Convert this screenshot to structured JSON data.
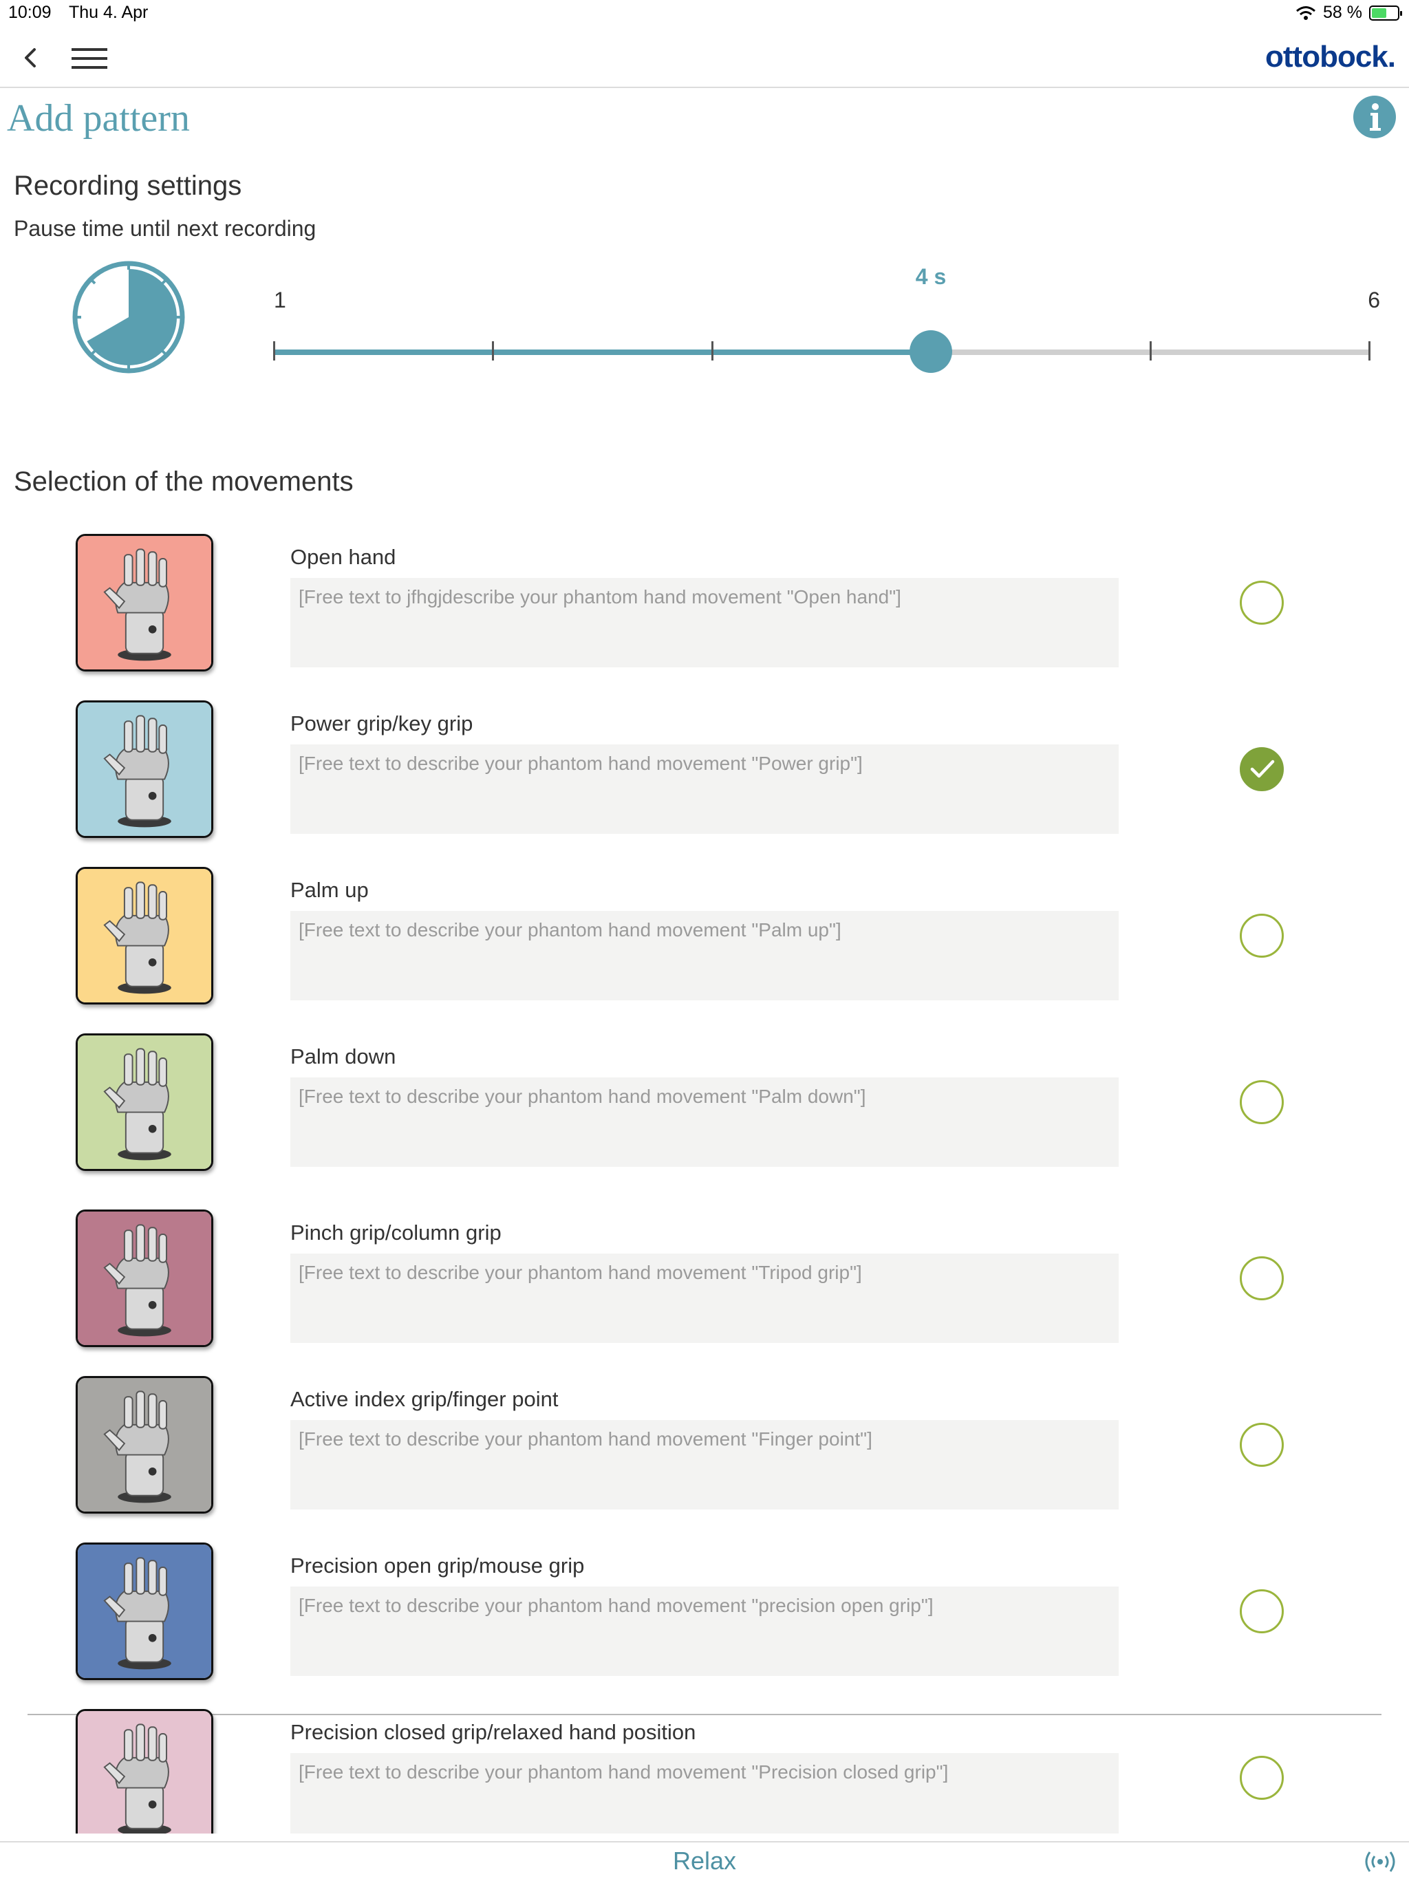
{
  "status_bar": {
    "time": "10:09",
    "date": "Thu 4. Apr",
    "battery_percent_text": "58 %",
    "battery_level": 0.58
  },
  "nav": {
    "brand": "ottobock."
  },
  "page": {
    "title": "Add pattern"
  },
  "recording_settings": {
    "heading": "Recording settings",
    "pause_label": "Pause time until next recording",
    "slider": {
      "min": 1,
      "max": 6,
      "value": 4,
      "min_label": "1",
      "max_label": "6",
      "value_label": "4 s"
    }
  },
  "movements": {
    "heading": "Selection of the movements",
    "items": [
      {
        "label": "Open hand",
        "placeholder": "[Free text to jfhgjdescribe your phantom hand movement \"Open hand\"]",
        "tile_color": "#f4a093",
        "selected": false
      },
      {
        "label": "Power grip/key grip",
        "placeholder": "[Free text to describe your phantom hand movement \"Power grip\"]",
        "tile_color": "#a9d2dd",
        "selected": true
      },
      {
        "label": "Palm up",
        "placeholder": "[Free text to describe your phantom hand movement \"Palm up\"]",
        "tile_color": "#fcd88a",
        "selected": false
      },
      {
        "label": "Palm down",
        "placeholder": "[Free text to describe your phantom hand movement \"Palm down\"]",
        "tile_color": "#c9dba4",
        "selected": false
      },
      {
        "label": "Pinch grip/column grip",
        "placeholder": "[Free text to describe your phantom hand movement \"Tripod grip\"]",
        "tile_color": "#b97a8c",
        "selected": false
      },
      {
        "label": "Active index grip/finger point",
        "placeholder": "[Free text to describe your phantom hand movement \"Finger point\"]",
        "tile_color": "#a7a6a3",
        "selected": false
      },
      {
        "label": "Precision open grip/mouse grip",
        "placeholder": "[Free text to describe your phantom hand movement \"precision open grip\"]",
        "tile_color": "#5e7fb6",
        "selected": false
      },
      {
        "label": "Precision closed grip/relaxed hand position",
        "placeholder": "[Free text to describe your phantom hand movement \"Precision closed grip\"]",
        "tile_color": "#e6c3d0",
        "selected": false
      }
    ]
  },
  "bottom_bar": {
    "label": "Relax"
  },
  "colors": {
    "accent": "#5a9fb0",
    "brand": "#0b3a8c",
    "check_green": "#7fa23a",
    "circle_outline": "#9ab53c"
  }
}
